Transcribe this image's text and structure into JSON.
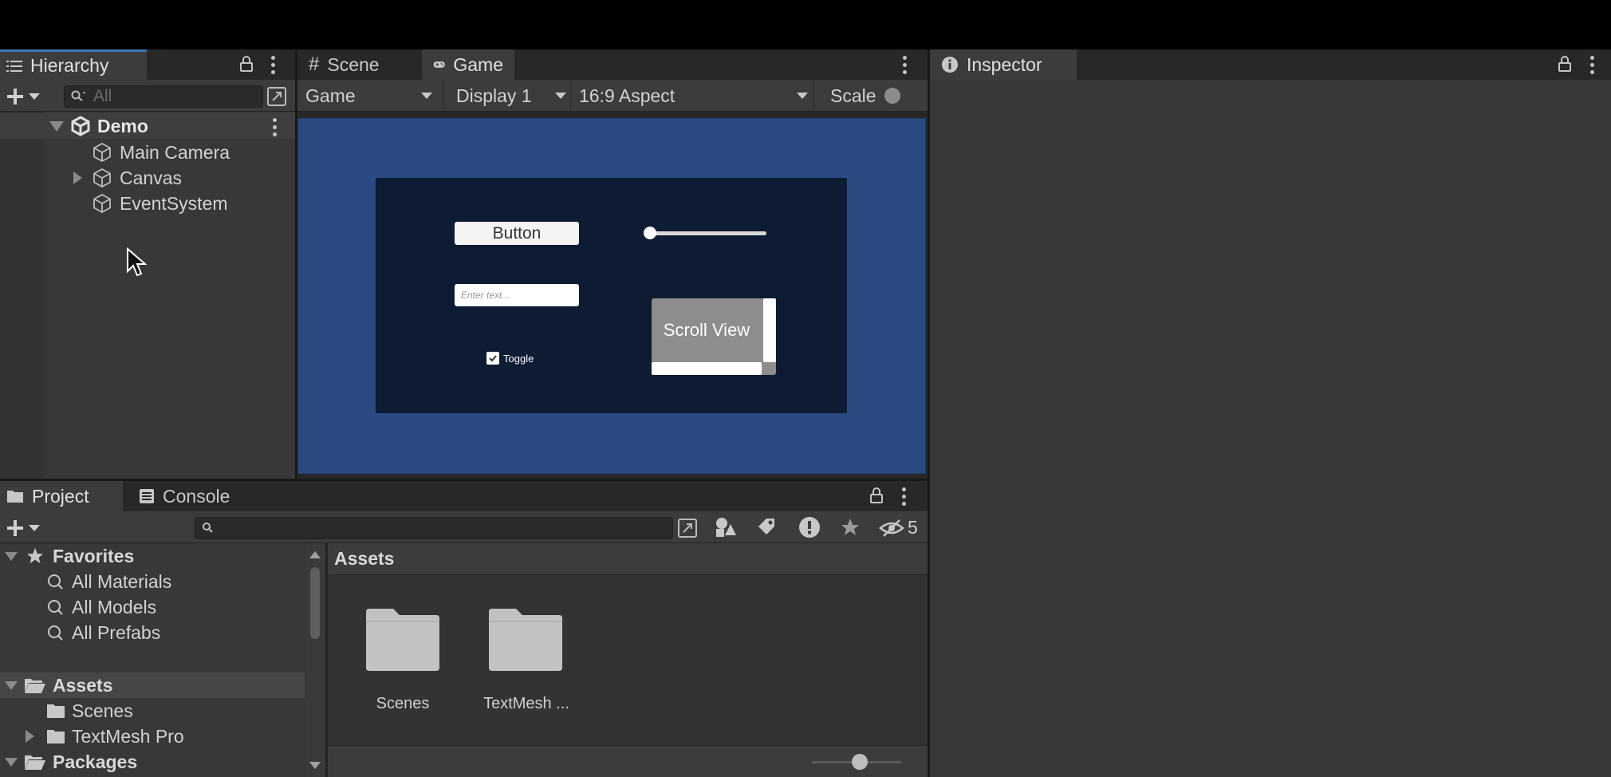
{
  "hierarchy": {
    "tab_label": "Hierarchy",
    "search_placeholder": "All",
    "scene_name": "Demo",
    "items": [
      {
        "label": "Main Camera"
      },
      {
        "label": "Canvas"
      },
      {
        "label": "EventSystem"
      }
    ]
  },
  "game_panel": {
    "tabs": [
      {
        "label": "Scene"
      },
      {
        "label": "Game"
      }
    ],
    "view_dropdown": "Game",
    "display_dropdown": "Display 1",
    "aspect_dropdown": "16:9 Aspect",
    "scale_label": "Scale",
    "ui": {
      "button_label": "Button",
      "input_placeholder": "Enter text...",
      "toggle_label": "Toggle",
      "scroll_view_label": "Scroll View",
      "slider_value": 0
    }
  },
  "inspector": {
    "tab_label": "Inspector"
  },
  "project": {
    "tabs": [
      {
        "label": "Project"
      },
      {
        "label": "Console"
      }
    ],
    "hidden_count": "5",
    "favorites": {
      "label": "Favorites",
      "items": [
        {
          "label": "All Materials"
        },
        {
          "label": "All Models"
        },
        {
          "label": "All Prefabs"
        }
      ]
    },
    "assets_tree": {
      "label": "Assets",
      "items": [
        {
          "label": "Scenes"
        },
        {
          "label": "TextMesh Pro"
        }
      ]
    },
    "packages_label": "Packages",
    "breadcrumb": "Assets",
    "grid_items": [
      {
        "label": "Scenes"
      },
      {
        "label": "TextMesh ..."
      }
    ]
  },
  "colors": {
    "accent": "#3a79bb",
    "game_bg": "#2b4a82",
    "canvas_bg": "#0d1b33"
  }
}
